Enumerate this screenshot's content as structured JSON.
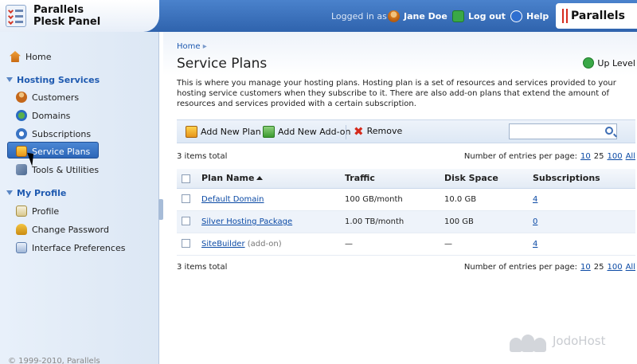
{
  "header": {
    "product_name_line1": "Parallels",
    "product_name_line2": "Plesk Panel",
    "logged_in_label": "Logged in as",
    "user_name": "Jane Doe",
    "logout_label": "Log out",
    "help_label": "Help",
    "brand": "Parallels"
  },
  "sidebar": {
    "home": "Home",
    "groups": [
      {
        "label": "Hosting Services"
      },
      {
        "label": "My Profile"
      }
    ],
    "hosting_items": [
      "Customers",
      "Domains",
      "Subscriptions",
      "Service Plans",
      "Tools & Utilities"
    ],
    "profile_items": [
      "Profile",
      "Change Password",
      "Interface Preferences"
    ],
    "copyright": "© 1999-2010, Parallels"
  },
  "main": {
    "breadcrumb": "Home",
    "title": "Service Plans",
    "up_level": "Up Level",
    "description": "This is where you manage your hosting plans. Hosting plan is a set of resources and services provided to your hosting service customers when they subscribe to it. There are also add-on plans that extend the amount of resources and services provided with a certain subscription.",
    "toolbar": {
      "add_plan": "Add New Plan",
      "add_addon": "Add New Add-on",
      "remove": "Remove",
      "search_value": ""
    },
    "total": "3 items total",
    "pager": {
      "label": "Number of entries per page:",
      "options": [
        "10",
        "25",
        "100",
        "All"
      ]
    },
    "table": {
      "headers": [
        "Plan Name",
        "Traffic",
        "Disk Space",
        "Subscriptions"
      ],
      "rows": [
        {
          "name": "Default Domain",
          "suffix": "",
          "traffic": "100 GB/month",
          "disk": "10.0 GB",
          "subs": "4"
        },
        {
          "name": "Silver Hosting Package",
          "suffix": "",
          "traffic": "1.00 TB/month",
          "disk": "100 GB",
          "subs": "0"
        },
        {
          "name": "SiteBuilder",
          "suffix": "(add-on)",
          "traffic": "—",
          "disk": "—",
          "subs": "4"
        }
      ]
    }
  },
  "watermark": "JodoHost"
}
